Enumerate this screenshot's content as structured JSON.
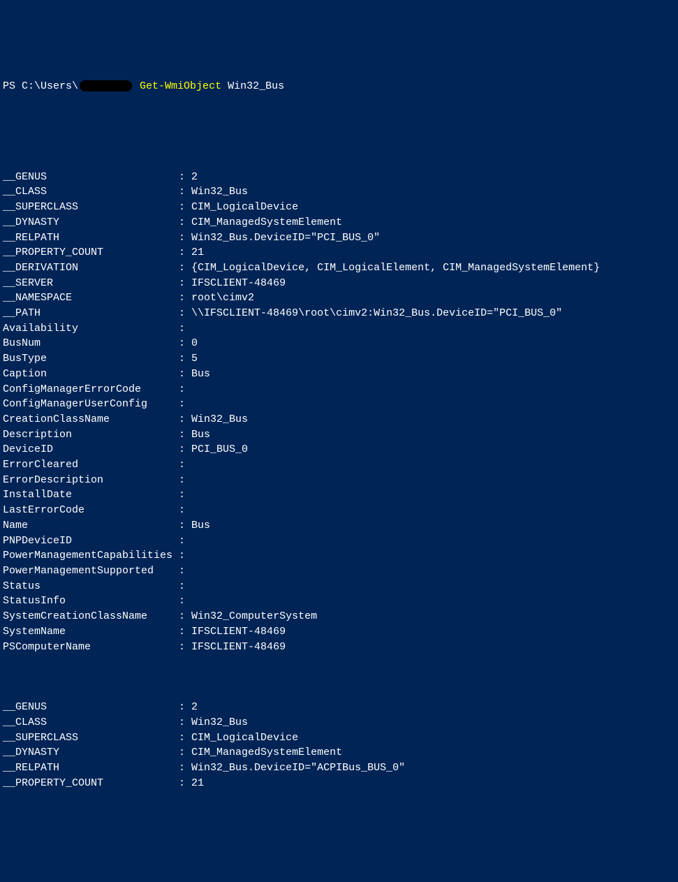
{
  "prompt": {
    "prefix": "PS C:\\Users\\",
    "cmdlet": "Get-WmiObject",
    "argument": " Win32_Bus"
  },
  "output_block1": [
    {
      "name": "__GENUS",
      "value": "2"
    },
    {
      "name": "__CLASS",
      "value": "Win32_Bus"
    },
    {
      "name": "__SUPERCLASS",
      "value": "CIM_LogicalDevice"
    },
    {
      "name": "__DYNASTY",
      "value": "CIM_ManagedSystemElement"
    },
    {
      "name": "__RELPATH",
      "value": "Win32_Bus.DeviceID=\"PCI_BUS_0\""
    },
    {
      "name": "__PROPERTY_COUNT",
      "value": "21"
    },
    {
      "name": "__DERIVATION",
      "value": "{CIM_LogicalDevice, CIM_LogicalElement, CIM_ManagedSystemElement}"
    },
    {
      "name": "__SERVER",
      "value": "IFSCLIENT-48469"
    },
    {
      "name": "__NAMESPACE",
      "value": "root\\cimv2"
    },
    {
      "name": "__PATH",
      "value": "\\\\IFSCLIENT-48469\\root\\cimv2:Win32_Bus.DeviceID=\"PCI_BUS_0\""
    },
    {
      "name": "Availability",
      "value": ""
    },
    {
      "name": "BusNum",
      "value": "0"
    },
    {
      "name": "BusType",
      "value": "5"
    },
    {
      "name": "Caption",
      "value": "Bus"
    },
    {
      "name": "ConfigManagerErrorCode",
      "value": ""
    },
    {
      "name": "ConfigManagerUserConfig",
      "value": ""
    },
    {
      "name": "CreationClassName",
      "value": "Win32_Bus"
    },
    {
      "name": "Description",
      "value": "Bus"
    },
    {
      "name": "DeviceID",
      "value": "PCI_BUS_0"
    },
    {
      "name": "ErrorCleared",
      "value": ""
    },
    {
      "name": "ErrorDescription",
      "value": ""
    },
    {
      "name": "InstallDate",
      "value": ""
    },
    {
      "name": "LastErrorCode",
      "value": ""
    },
    {
      "name": "Name",
      "value": "Bus"
    },
    {
      "name": "PNPDeviceID",
      "value": ""
    },
    {
      "name": "PowerManagementCapabilities",
      "value": ""
    },
    {
      "name": "PowerManagementSupported",
      "value": ""
    },
    {
      "name": "Status",
      "value": ""
    },
    {
      "name": "StatusInfo",
      "value": ""
    },
    {
      "name": "SystemCreationClassName",
      "value": "Win32_ComputerSystem"
    },
    {
      "name": "SystemName",
      "value": "IFSCLIENT-48469"
    },
    {
      "name": "PSComputerName",
      "value": "IFSCLIENT-48469"
    }
  ],
  "output_block2": [
    {
      "name": "__GENUS",
      "value": "2"
    },
    {
      "name": "__CLASS",
      "value": "Win32_Bus"
    },
    {
      "name": "__SUPERCLASS",
      "value": "CIM_LogicalDevice"
    },
    {
      "name": "__DYNASTY",
      "value": "CIM_ManagedSystemElement"
    },
    {
      "name": "__RELPATH",
      "value": "Win32_Bus.DeviceID=\"ACPIBus_BUS_0\""
    },
    {
      "name": "__PROPERTY_COUNT",
      "value": "21"
    }
  ]
}
